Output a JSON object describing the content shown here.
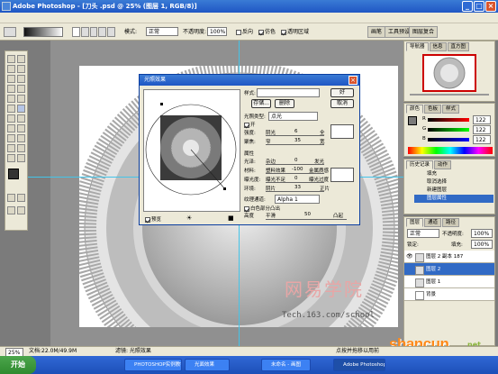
{
  "window": {
    "title": "Adobe Photoshop - [刀头 .psd @ 25% (图层 1, RGB/8)]"
  },
  "options": {
    "mode_label": "模式:",
    "mode_value": "正常",
    "opacity_label": "不透明度:",
    "opacity_value": "100%",
    "reverse_label": "反向",
    "dither_label": "仿色",
    "transparency_label": "透明区域"
  },
  "palette_well": {
    "tabs": [
      "画笔",
      "工具预设",
      "图层复合"
    ]
  },
  "lighting_dialog": {
    "title": "光照效果",
    "style_label": "样式:",
    "ok": "好",
    "save": "存储...",
    "delete": "删除",
    "cancel": "取消",
    "light_type_label": "光照类型:",
    "light_type_value": "点光",
    "on_label": "开",
    "intensity_label": "强度:",
    "intensity_low": "阴光",
    "intensity_value": "6",
    "intensity_high": "全",
    "focus_label": "聚焦:",
    "focus_low": "窄",
    "focus_value": "35",
    "focus_high": "宽",
    "properties_label": "属性",
    "gloss_label": "光泽:",
    "gloss_low": "杂边",
    "gloss_value": "0",
    "gloss_high": "发光",
    "material_label": "材料:",
    "material_low": "塑料效果",
    "material_value": "-100",
    "material_high": "金属质感",
    "exposure_label": "曝光度:",
    "exposure_low": "曝光不足",
    "exposure_value": "0",
    "exposure_high": "曝光过度",
    "ambience_label": "环境:",
    "ambience_low": "阴片",
    "ambience_value": "33",
    "ambience_high": "正片",
    "texture_label": "纹理通道:",
    "texture_value": "Alpha 1",
    "white_high_label": "白色部分凸出",
    "height_label": "高度",
    "height_low": "平滑",
    "height_value": "50",
    "height_high": "凸起",
    "preview_label": "预览"
  },
  "navigator": {
    "tabs": [
      "导航器",
      "信息",
      "直方图"
    ]
  },
  "color_panel": {
    "tabs": [
      "颜色",
      "色板",
      "样式"
    ],
    "channels": [
      {
        "label": "R",
        "value": "122"
      },
      {
        "label": "G",
        "value": "122"
      },
      {
        "label": "B",
        "value": "122"
      }
    ]
  },
  "history_panel": {
    "tabs": [
      "历史记录",
      "动作"
    ],
    "items": [
      "填充",
      "取消选择",
      "新建图层",
      "图层属性"
    ]
  },
  "layers_panel": {
    "tabs": [
      "图层",
      "通道",
      "路径"
    ],
    "blend": "正常",
    "opacity_label": "不透明度:",
    "opacity_value": "100%",
    "lock_label": "锁定:",
    "fill_label": "填充:",
    "fill_value": "100%",
    "layers": [
      "图层 2 副本 187",
      "图层 2",
      "图层 1",
      "背景"
    ]
  },
  "watermark": {
    "text": "网易学院",
    "url": "Tech.163.com/school"
  },
  "logo": {
    "text": "shancun",
    "sub": "net"
  },
  "status": {
    "zoom": "25%",
    "doc": "文档:22.0M/49.9M",
    "tool": "滤镜: 光照效果",
    "hint": "点按并拖移以用前"
  },
  "taskbar": {
    "start": "开始",
    "items": [
      "PHOTOSHOP实例教学",
      "光面效果",
      "未命名 - 画图",
      "Adobe Photoshop"
    ]
  }
}
